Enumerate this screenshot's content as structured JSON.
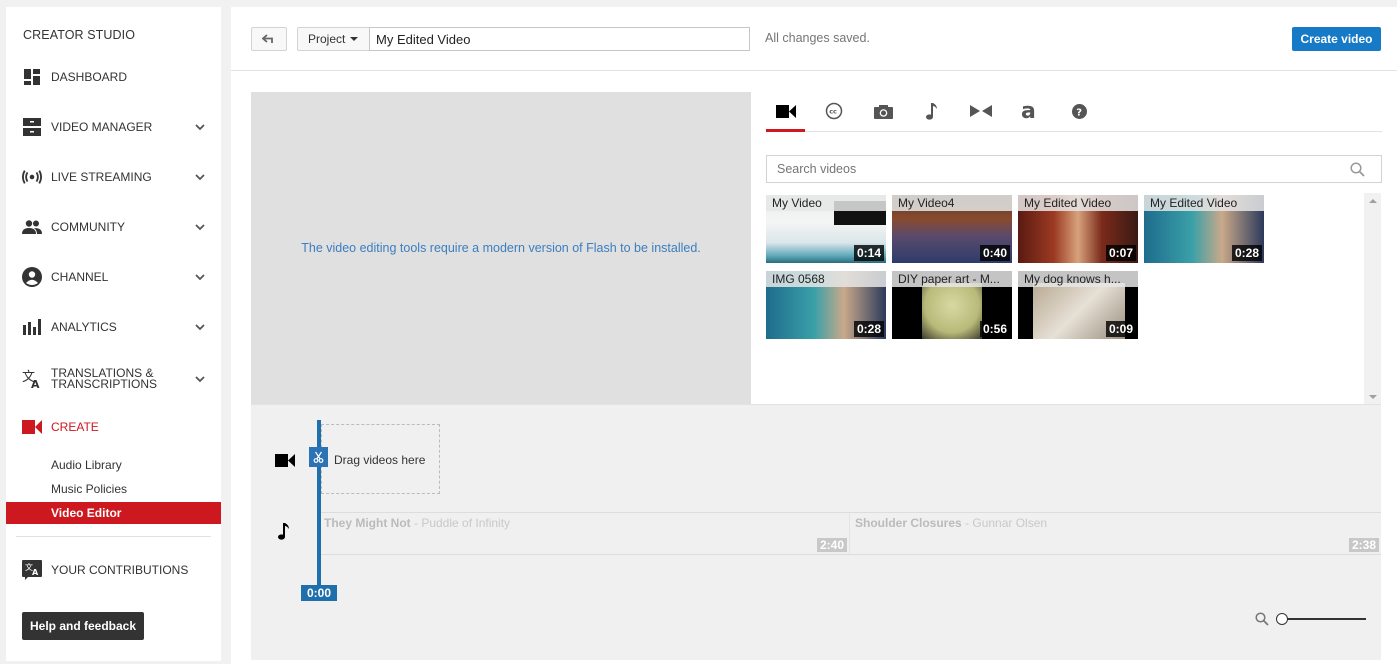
{
  "sidebar": {
    "title": "CREATOR STUDIO",
    "items": [
      {
        "label": "DASHBOARD",
        "icon": "dashboard-icon",
        "expandable": false
      },
      {
        "label": "VIDEO MANAGER",
        "icon": "video-manager-icon",
        "expandable": true
      },
      {
        "label": "LIVE STREAMING",
        "icon": "live-streaming-icon",
        "expandable": true
      },
      {
        "label": "COMMUNITY",
        "icon": "community-icon",
        "expandable": true
      },
      {
        "label": "CHANNEL",
        "icon": "channel-icon",
        "expandable": true
      },
      {
        "label": "ANALYTICS",
        "icon": "analytics-icon",
        "expandable": true
      },
      {
        "label_line1": "TRANSLATIONS &",
        "label_line2": "TRANSCRIPTIONS",
        "icon": "translate-icon",
        "expandable": true
      },
      {
        "label": "CREATE",
        "icon": "create-video-icon",
        "expandable": false,
        "active": true
      }
    ],
    "create_subitems": [
      {
        "label": "Audio Library"
      },
      {
        "label": "Music Policies"
      },
      {
        "label": "Video Editor",
        "active": true
      }
    ],
    "contributions_label": "YOUR CONTRIBUTIONS",
    "help_label": "Help and feedback"
  },
  "toolbar": {
    "project_label": "Project",
    "project_title": "My Edited Video",
    "save_status": "All changes saved.",
    "create_label": "Create video"
  },
  "preview": {
    "message": "The video editing tools require a modern version of Flash to be installed."
  },
  "tabs": [
    {
      "name": "videos",
      "icon": "video-camera-icon",
      "active": true
    },
    {
      "name": "creative-commons",
      "icon": "creative-commons-icon"
    },
    {
      "name": "photos",
      "icon": "camera-icon"
    },
    {
      "name": "audio",
      "icon": "music-note-icon"
    },
    {
      "name": "transitions",
      "icon": "transitions-icon"
    },
    {
      "name": "text",
      "icon": "text-icon"
    },
    {
      "name": "help",
      "icon": "help-icon"
    }
  ],
  "search": {
    "placeholder": "Search videos",
    "value": ""
  },
  "videos": [
    {
      "title": "My Video",
      "duration": "0:14"
    },
    {
      "title": "My Video4",
      "duration": "0:40"
    },
    {
      "title": "My Edited Video",
      "duration": "0:07"
    },
    {
      "title": "My Edited Video",
      "duration": "0:28"
    },
    {
      "title": "IMG 0568",
      "duration": "0:28"
    },
    {
      "title": "DIY paper art - M...",
      "duration": "0:56"
    },
    {
      "title": "My dog knows h...",
      "duration": "0:09"
    }
  ],
  "timeline": {
    "drop_text": "Drag videos here",
    "playhead_time": "0:00",
    "audio_clips": [
      {
        "song": "They Might Not",
        "artist": "Puddle of Infinity",
        "duration": "2:40"
      },
      {
        "song": "Shoulder Closures",
        "artist": "Gunnar Olsen",
        "duration": "2:38"
      }
    ],
    "zoom_level": 0
  },
  "colors": {
    "accent_red": "#cc181e",
    "accent_blue": "#167ac6",
    "flash_message": "#3b7ec0"
  }
}
